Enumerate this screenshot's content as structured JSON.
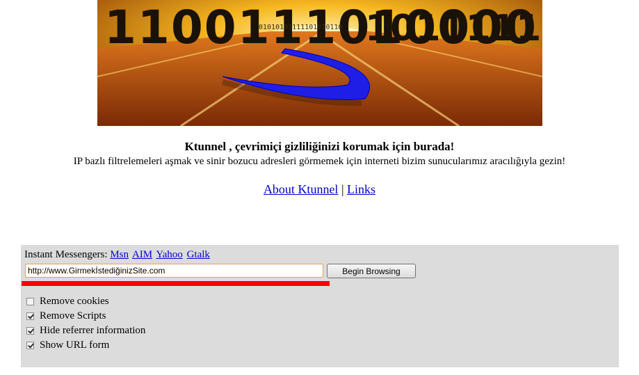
{
  "banner": {
    "digits_back": "1100111010000101",
    "digits_mid": "10111111000111010",
    "digits_tunnel": "01010101111101010110"
  },
  "headline": "Ktunnel , çevrimiçi gizliliğinizi korumak için burada!",
  "subline": "IP bazlı filtrelemeleri aşmak ve sinir bozucu adresleri görmemek için interneti bizim sunucularımız aracılığıyla gezin!",
  "nav": {
    "about": "About Ktunnel",
    "separator": "|",
    "links": "Links"
  },
  "panel": {
    "im_label": "Instant Messengers:",
    "im_links": [
      "Msn",
      "AIM",
      "Yahoo",
      "Gtalk"
    ],
    "url_value": "http://www.GirmekİstediğinizSite.com",
    "begin_button": "Begin Browsing",
    "options": [
      {
        "label": "Remove cookies",
        "checked": false
      },
      {
        "label": "Remove Scripts",
        "checked": true
      },
      {
        "label": "Hide referrer information",
        "checked": true
      },
      {
        "label": "Show URL form",
        "checked": true
      }
    ]
  },
  "colors": {
    "highlight_line": "#ff0000",
    "panel_bg": "#dcdcdc",
    "link": "#0000cc"
  }
}
